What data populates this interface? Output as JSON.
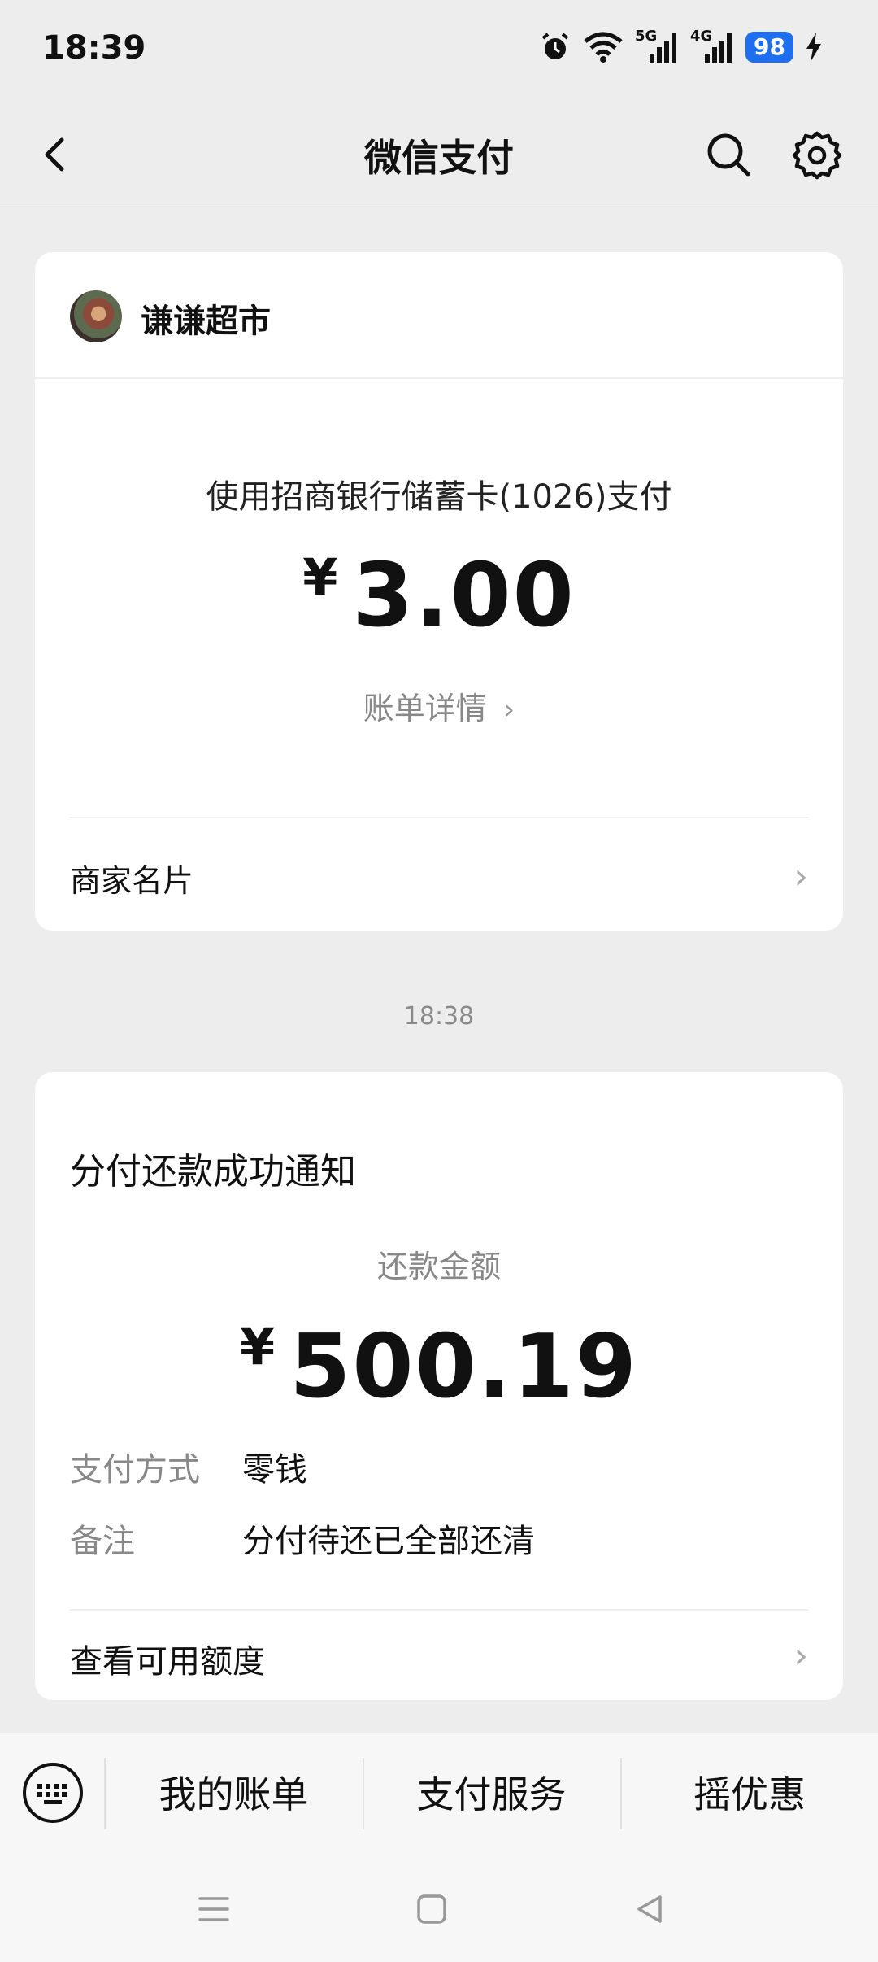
{
  "status_bar": {
    "time": "18:39",
    "network_5g": "5G",
    "network_4g": "4G",
    "battery": "98",
    "icons": [
      "alarm-icon",
      "wifi-icon",
      "signal-5g-icon",
      "signal-4g-icon",
      "battery-icon",
      "charging-icon"
    ]
  },
  "nav": {
    "title": "微信支付",
    "icons": [
      "back-icon",
      "search-icon",
      "settings-icon"
    ]
  },
  "payment_card": {
    "merchant_name": "谦谦超市",
    "pay_method": "使用招商银行储蓄卡(1026)支付",
    "currency": "¥",
    "amount": "3.00",
    "bill_detail": "账单详情",
    "merchant_card_link": "商家名片"
  },
  "timestamp": "18:38",
  "repay_card": {
    "title": "分付还款成功通知",
    "amount_label": "还款金额",
    "currency": "¥",
    "amount": "500.19",
    "pay_method_label": "支付方式",
    "pay_method_value": "零钱",
    "note_label": "备注",
    "note_value": "分付待还已全部还清",
    "credit_link": "查看可用额度"
  },
  "bottom_menu": {
    "items": [
      "我的账单",
      "支付服务",
      "摇优惠"
    ]
  },
  "colors": {
    "background": "#ededed",
    "card": "#ffffff",
    "battery": "#1e6ff0",
    "secondary_text": "#888888"
  }
}
